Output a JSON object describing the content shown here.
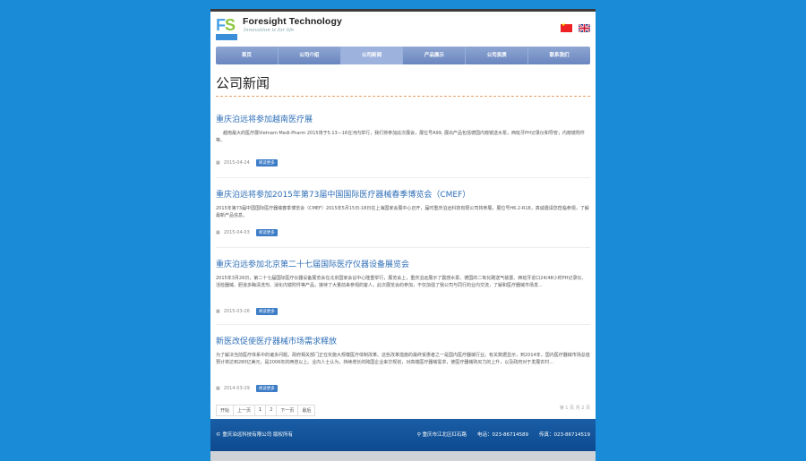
{
  "header": {
    "company_name": "Foresight Technology",
    "tagline": "Innovation is for life",
    "logo_letters": "FS",
    "logo_sub": "泊远科技"
  },
  "nav": {
    "items": [
      {
        "label": "首页"
      },
      {
        "label": "公司介绍"
      },
      {
        "label": "公司新闻"
      },
      {
        "label": "产品展示"
      },
      {
        "label": "公司资质"
      },
      {
        "label": "联系我们"
      }
    ]
  },
  "main": {
    "title": "公司新闻",
    "news": [
      {
        "title": "重庆泊远将参加越南医疗展",
        "body": "越南最大的医疗展Vietnam Medi-Pharm 2015将于5.13—16在河内举行，我们将参加此次展会，展位号A99, 展出产品包括德国内窥镜送水泵，西班牙PH记录仪和导管；内窥镜附件等。",
        "date": "2015-04-24",
        "more": "阅读更多"
      },
      {
        "title": "重庆泊远将参加2015年第73届中国国际医疗器械春季博览会（CMEF）",
        "body": "2015年第73届中国国际医疗器械春季博览会（CMEF）2015年5月15日-18日在上海国家会展中心召开，届时重庆泊远科技有限公司将参展，展位号H6.2-R18，真诚邀请您莅临参观，了解最新产品信息。",
        "date": "2015-04-03",
        "more": "阅读更多"
      },
      {
        "title": "重庆泊远参加北京第二十七届国际医疗仪器设备展览会",
        "body": "2015年3月26日，第二十七届国际医疗仪器设备展览会在北京国家会议中心隆重举行，展览会上，重庆泊远展示了震感水泵、德国的二氧化碳送气装置、西班牙进口24/48小时PH记录仪、活检器械、胆道多酶清洗剂、消化内镜附件等产品，接待了大量前来参观的客人。此次展览会的参加，不仅加强了我公司与同行的业内交流，了解和医疗器械市场发...",
        "date": "2015-03-26",
        "more": "阅读更多"
      },
      {
        "title": "新医改促使医疗器械市场需求释放",
        "body": "为了解决当前医疗体系中的诸多问题，政府相关部门正在实施大规模医疗体制改革。这些改革措施的最终受惠者之一是国内医疗器械行业。有关数据显示，到2014年，国内医疗器械市场总值预计将达到280亿美元，是2006年的两倍以上。业内人士认为，持续增长的跨国企业来华规划，对高端医疗器械需求，使医疗器械购买力的上升，以及政府对于发展农村...",
        "date": "2014-03-29",
        "more": "阅读更多"
      }
    ]
  },
  "pager": {
    "items": [
      "开始",
      "上一页",
      "1",
      "2",
      "下一页",
      "最后"
    ],
    "summary": "第 1 页 共 2 页"
  },
  "footer": {
    "copyright": "© 重庆泊远科技有限公司 版权所有",
    "address": "重庆市江北区红石路",
    "phone": "电话：023-86714589",
    "fax": "传真：023-86714519"
  },
  "colors": {
    "background": "#1a8bd6",
    "nav": "#7b95c9",
    "link": "#2f6fb7",
    "footer": "#135599"
  }
}
